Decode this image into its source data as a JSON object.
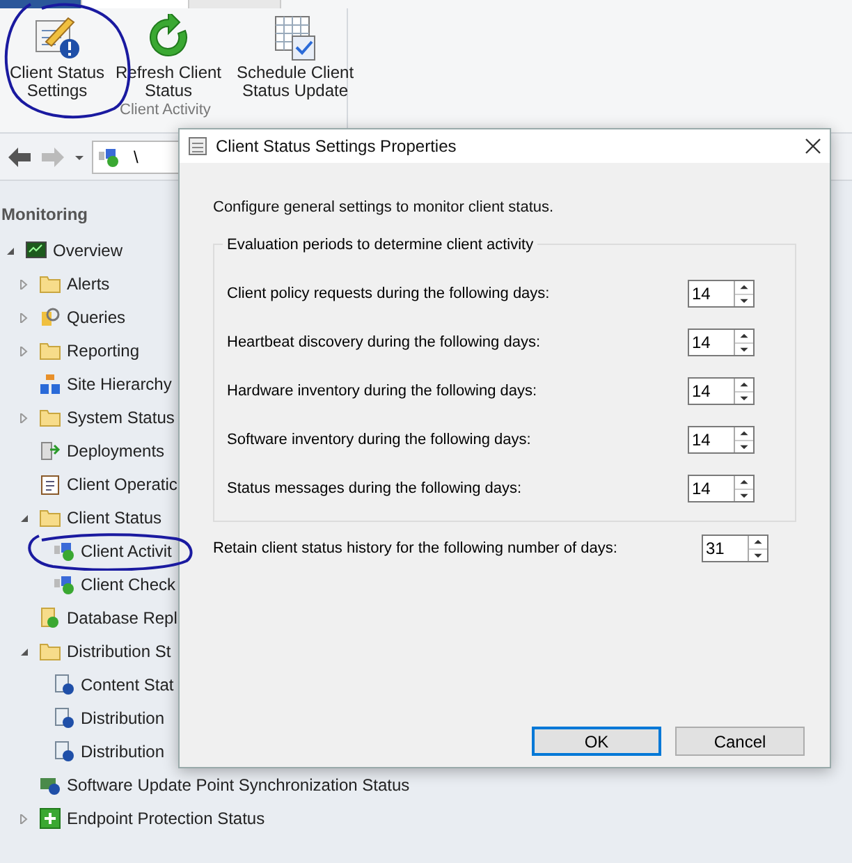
{
  "ribbon": {
    "buttons": [
      {
        "label": "Client Status Settings",
        "kind": "settings"
      },
      {
        "label": "Refresh Client Status",
        "kind": "refresh"
      },
      {
        "label": "Schedule Client Status Update",
        "kind": "schedule"
      }
    ],
    "group_label": "Client Activity"
  },
  "address_bar": {
    "path": "\\"
  },
  "sidebar": {
    "title": "Monitoring",
    "items": [
      {
        "label": "Overview",
        "kind": "overview",
        "expanded": true,
        "children": [
          {
            "label": "Alerts",
            "kind": "folder",
            "expanded": false
          },
          {
            "label": "Queries",
            "kind": "query",
            "expanded": false
          },
          {
            "label": "Reporting",
            "kind": "folder",
            "expanded": false
          },
          {
            "label": "Site Hierarchy",
            "kind": "hierarchy"
          },
          {
            "label": "System Status",
            "kind": "folder",
            "expanded": false
          },
          {
            "label": "Deployments",
            "kind": "deploy"
          },
          {
            "label": "Client Operatic",
            "kind": "clipboard"
          },
          {
            "label": "Client Status",
            "kind": "folder",
            "expanded": true,
            "children": [
              {
                "label": "Client Activit",
                "kind": "client"
              },
              {
                "label": "Client Check",
                "kind": "client"
              }
            ]
          },
          {
            "label": "Database Repl",
            "kind": "database"
          },
          {
            "label": "Distribution St",
            "kind": "folder",
            "expanded": true,
            "children": [
              {
                "label": "Content Stat",
                "kind": "status"
              },
              {
                "label": "Distribution",
                "kind": "status"
              },
              {
                "label": "Distribution",
                "kind": "status"
              }
            ]
          },
          {
            "label": "Software Update Point Synchronization Status",
            "kind": "update"
          },
          {
            "label": "Endpoint Protection Status",
            "kind": "shield",
            "expanded": false
          }
        ]
      }
    ]
  },
  "dialog": {
    "title": "Client Status Settings Properties",
    "intro": "Configure general settings to monitor client status.",
    "group": {
      "title": "Evaluation periods to determine client activity",
      "rows": [
        {
          "label": "Client policy requests during the following days:",
          "value": "14"
        },
        {
          "label": "Heartbeat discovery during the following days:",
          "value": "14"
        },
        {
          "label": "Hardware inventory during the following days:",
          "value": "14"
        },
        {
          "label": "Software inventory during the following days:",
          "value": "14"
        },
        {
          "label": "Status messages during the following days:",
          "value": "14"
        }
      ]
    },
    "retain": {
      "label": "Retain client status history for the following number of days:",
      "value": "31"
    },
    "buttons": [
      {
        "label": "OK",
        "kind": "default"
      },
      {
        "label": "Cancel",
        "kind": "normal"
      }
    ]
  }
}
